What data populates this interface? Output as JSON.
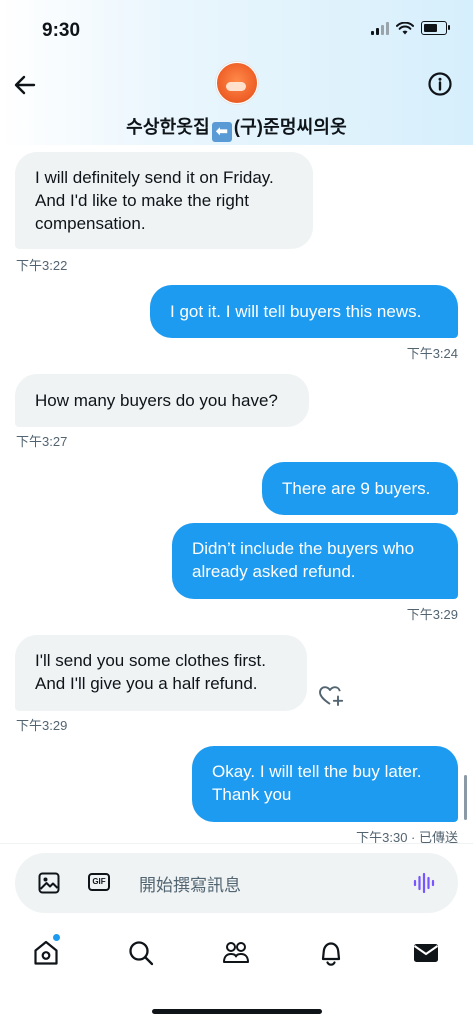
{
  "status_bar": {
    "time": "9:30"
  },
  "header": {
    "title_before": "수상한옷집",
    "title_arrow": "⬅",
    "title_after": "(구)준멍씨의옷"
  },
  "messages": [
    {
      "direction": "in",
      "text": "I will definitely send it on Friday. And I'd like to make the right compensation.",
      "time": "下午3:22"
    },
    {
      "direction": "out",
      "text": "I got it. I will tell buyers this news.",
      "time": "下午3:24"
    },
    {
      "direction": "in",
      "text": "How many buyers do you have?",
      "time": "下午3:27"
    },
    {
      "direction": "out",
      "text": "There are 9 buyers.",
      "time": ""
    },
    {
      "direction": "out",
      "text": "Didn’t include the buyers who already asked refund.",
      "time": "下午3:29"
    },
    {
      "direction": "in",
      "text": "I'll send you some clothes first. And I'll give you a half refund.",
      "time": "下午3:29"
    },
    {
      "direction": "out",
      "text": "Okay. I will tell the buy later. Thank you",
      "time": "下午3:30 · 已傳送"
    }
  ],
  "composer": {
    "placeholder": "開始撰寫訊息",
    "gif_label": "GIF"
  },
  "nav": [
    "home-icon",
    "search-icon",
    "communities-icon",
    "notifications-icon",
    "messages-icon"
  ],
  "colors": {
    "accent": "#1d9bf0",
    "incoming_bubble": "#eff3f4",
    "voice": "#7856ff"
  }
}
